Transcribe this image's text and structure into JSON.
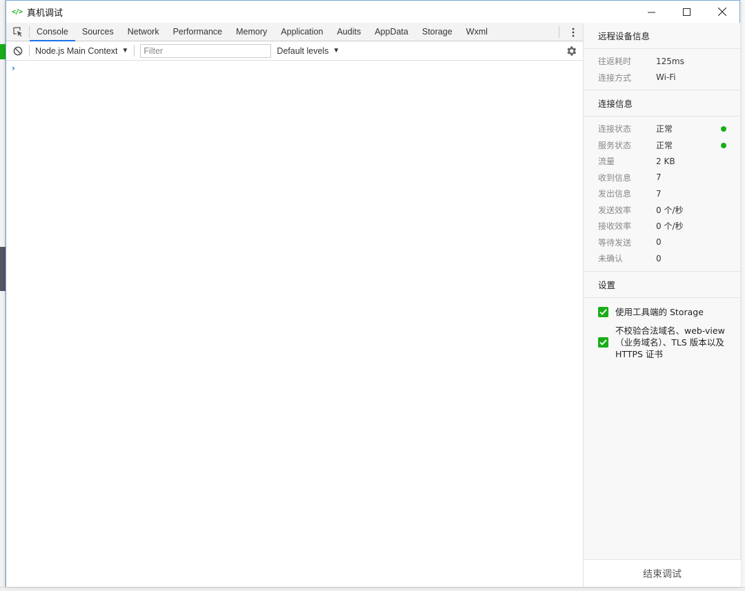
{
  "window": {
    "title": "真机调试"
  },
  "devtools": {
    "tabs": [
      "Console",
      "Sources",
      "Network",
      "Performance",
      "Memory",
      "Application",
      "Audits",
      "AppData",
      "Storage",
      "Wxml"
    ],
    "active_tab": "Console",
    "context": "Node.js Main Context",
    "filter_placeholder": "Filter",
    "levels": "Default levels",
    "prompt": "›"
  },
  "panel": {
    "remote": {
      "title": "远程设备信息",
      "rows": [
        {
          "key": "往返耗时",
          "value": "125ms"
        },
        {
          "key": "连接方式",
          "value": "Wi-Fi"
        }
      ]
    },
    "connection": {
      "title": "连接信息",
      "rows": [
        {
          "key": "连接状态",
          "value": "正常"
        },
        {
          "key": "服务状态",
          "value": "正常"
        },
        {
          "key": "流量",
          "value": "2 KB"
        },
        {
          "key": "收到信息",
          "value": "7"
        },
        {
          "key": "发出信息",
          "value": "7"
        },
        {
          "key": "发送效率",
          "value": "0 个/秒"
        },
        {
          "key": "接收效率",
          "value": "0 个/秒"
        },
        {
          "key": "等待发送",
          "value": "0"
        },
        {
          "key": "未确认",
          "value": "0"
        }
      ],
      "status_color": "#1aad19"
    },
    "settings": {
      "title": "设置",
      "options": [
        {
          "label": "使用工具端的 Storage",
          "checked": true
        },
        {
          "label": "不校验合法域名、web-view（业务域名）、TLS 版本以及 HTTPS 证书",
          "checked": true
        }
      ]
    },
    "end_button": "结束调试"
  },
  "colors": {
    "accent": "#1aad19",
    "tab_active": "#1a73e8"
  }
}
